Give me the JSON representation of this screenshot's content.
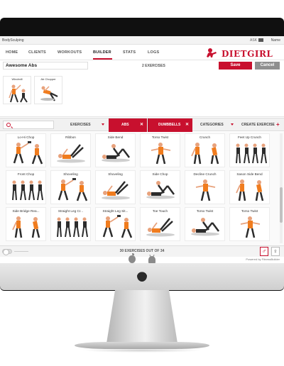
{
  "app": {
    "title": "BodySculping",
    "ask": "ASK",
    "user": "Name"
  },
  "nav": {
    "items": [
      {
        "label": "HOME"
      },
      {
        "label": "CLIENTS"
      },
      {
        "label": "WORKOUTS"
      },
      {
        "label": "BUILDER",
        "active": true
      },
      {
        "label": "STATS"
      },
      {
        "label": "LOGS"
      }
    ],
    "brand": "DIETGIRL"
  },
  "builder": {
    "routine_name": "Awesome Abs",
    "count_label": "2 EXERCISES",
    "save_label": "Save",
    "cancel_label": "Cancel",
    "selected": [
      {
        "label": "Windmill"
      },
      {
        "label": "Ab Chopper"
      }
    ]
  },
  "filters": {
    "exercises_label": "EXERCISES",
    "chips": [
      {
        "label": "ABS"
      },
      {
        "label": "DUMBBELLS"
      }
    ],
    "categories_label": "CATEGORIES",
    "create_label": "CREATE EXERCISE",
    "close_glyph": "✕",
    "plus_glyph": "+"
  },
  "exercises": [
    "Lo-Hi Chop",
    "Ribbon",
    "Side Bend",
    "Torso Twist",
    "Crunch",
    "Feet Up Crunch",
    "Front Chop",
    "Shoveling",
    "Shoveling",
    "Side Chop",
    "Decline Crunch",
    "Sason Side Bend",
    "Side Bridge Rea...",
    "Straight Leg Cr...",
    "Straight Leg Sit...",
    "Toe Touch",
    "Torso Twist",
    "Torso Twist"
  ],
  "footer": {
    "count_text": "30 EXERCISES OUT OF 34",
    "male_glyph": "♂",
    "female_glyph": "♀",
    "powered": "Powered by FitnessBuilder"
  },
  "colors": {
    "accent": "#c8102e",
    "skin": "#e8a27c",
    "shirt": "#f07c1e",
    "dark": "#2c2c2c"
  },
  "icons": [
    "search-icon",
    "mail-icon",
    "apple-icon",
    "android-icon",
    "male-icon",
    "female-icon"
  ]
}
